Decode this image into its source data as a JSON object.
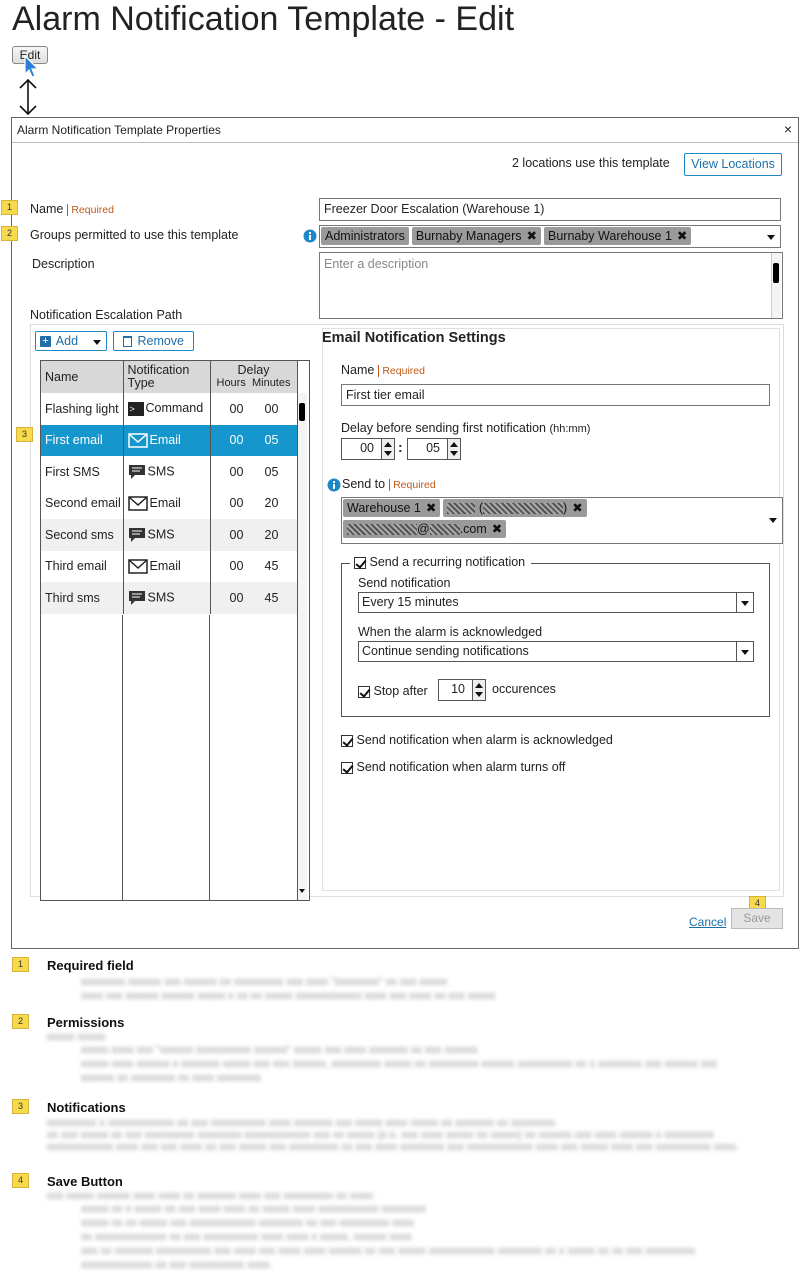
{
  "page": {
    "title": "Alarm Notification Template - Edit",
    "edit_button": "Edit"
  },
  "dialog": {
    "title": "Alarm Notification Template Properties",
    "close_glyph": "×",
    "locations_text": "2 locations use this template",
    "view_locations": "View Locations",
    "markers": [
      "1",
      "2",
      "3",
      "4"
    ],
    "name_label": "Name",
    "required_text": "Required",
    "name_value": "Freezer Door Escalation (Warehouse 1)",
    "groups_label": "Groups permitted to use this template",
    "groups": [
      "Administrators",
      "Burnaby Managers",
      "Burnaby Warehouse 1"
    ],
    "description_label": "Description",
    "description_placeholder": "Enter a description",
    "path_label": "Notification Escalation Path",
    "add_button": "Add",
    "remove_button": "Remove",
    "table": {
      "col_name": "Name",
      "col_type_1": "Notification",
      "col_type_2": "Type",
      "col_delay": "Delay",
      "col_hours": "Hours",
      "col_minutes": "Minutes",
      "rows": [
        {
          "name": "Flashing light",
          "icon": "command-icon",
          "type": "Command",
          "hours": "00",
          "minutes": "00"
        },
        {
          "name": "First email",
          "icon": "email-icon",
          "type": "Email",
          "hours": "00",
          "minutes": "05"
        },
        {
          "name": "First SMS",
          "icon": "sms-icon",
          "type": "SMS",
          "hours": "00",
          "minutes": "05"
        },
        {
          "name": "Second email",
          "icon": "email-icon",
          "type": "Email",
          "hours": "00",
          "minutes": "20"
        },
        {
          "name": "Second sms",
          "icon": "sms-icon",
          "type": "SMS",
          "hours": "00",
          "minutes": "20"
        },
        {
          "name": "Third email",
          "icon": "email-icon",
          "type": "Email",
          "hours": "00",
          "minutes": "45"
        },
        {
          "name": "Third sms",
          "icon": "sms-icon",
          "type": "SMS",
          "hours": "00",
          "minutes": "45"
        }
      ]
    },
    "email": {
      "heading": "Email Notification Settings",
      "name_label": "Name",
      "name_value": "First tier email",
      "delay_label": "Delay before sending first notification",
      "delay_unit": "(hh:mm)",
      "delay_hours": "00",
      "delay_colon": ":",
      "delay_minutes": "05",
      "send_to_label": "Send to",
      "recipients": [
        "Warehouse 1",
        "(",
        ")",
        "@",
        ".com"
      ],
      "recurring_label": "Send a recurring notification",
      "send_notification_label": "Send notification",
      "send_notification_value": "Every 15 minutes",
      "ack_label": "When the alarm is acknowledged",
      "ack_value": "Continue sending notifications",
      "stop_after_label": "Stop after",
      "stop_after_value": "10",
      "occurrences_label": "occurences",
      "send_ack_label": "Send notification when alarm is acknowledged",
      "send_off_label": "Send notification when alarm turns off"
    },
    "cancel": "Cancel",
    "save": "Save"
  },
  "notes": [
    {
      "num": "1",
      "title": "Required field"
    },
    {
      "num": "2",
      "title": "Permissions"
    },
    {
      "num": "3",
      "title": "Notifications"
    },
    {
      "num": "4",
      "title": "Save Button"
    }
  ],
  "colors": {
    "accent": "#1596cc",
    "marker": "#f7d94c",
    "required": "#c05a1a",
    "chip": "#9a9a9a"
  }
}
